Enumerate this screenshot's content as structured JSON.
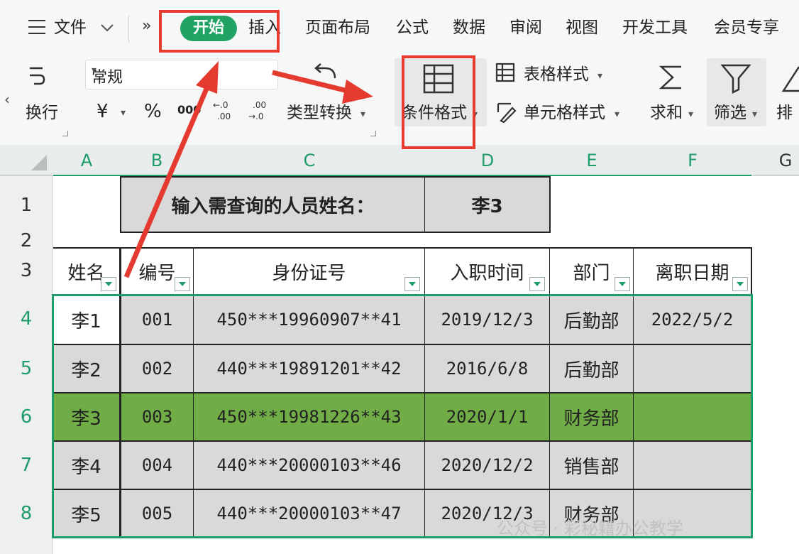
{
  "menu": {
    "file_label": "文件",
    "tabs": [
      "开始",
      "插入",
      "页面布局",
      "公式",
      "数据",
      "审阅",
      "视图",
      "开发工具",
      "会员专享"
    ],
    "active_tab": "开始"
  },
  "ribbon": {
    "wrap_label": "换行",
    "number_format": "常规",
    "currency_symbol": "¥",
    "percent_symbol": "%",
    "thousands_symbol": "000",
    "type_convert_label": "类型转换",
    "conditional_format_label": "条件格式",
    "table_style_label": "表格样式",
    "cell_style_label": "单元格样式",
    "sum_label": "求和",
    "filter_label": "筛选",
    "sort_label": "排"
  },
  "grid": {
    "columns": [
      "A",
      "B",
      "C",
      "D",
      "E",
      "F",
      "G"
    ],
    "rows": [
      "1",
      "2",
      "3",
      "4",
      "5",
      "6",
      "7",
      "8"
    ],
    "query_label": "输入需查询的人员姓名：",
    "query_value": "李3",
    "headers": [
      "姓名",
      "编号",
      "身份证号",
      "入职时间",
      "部门",
      "离职日期"
    ],
    "records": [
      {
        "name": "李1",
        "id": "001",
        "idcard": "450***19960907**41",
        "hire": "2019/12/3",
        "dept": "后勤部",
        "leave": "2022/5/2",
        "highlight": false
      },
      {
        "name": "李2",
        "id": "002",
        "idcard": "440***19891201**42",
        "hire": "2016/6/8",
        "dept": "后勤部",
        "leave": "",
        "highlight": false
      },
      {
        "name": "李3",
        "id": "003",
        "idcard": "450***19981226**43",
        "hire": "2020/1/1",
        "dept": "财务部",
        "leave": "",
        "highlight": true
      },
      {
        "name": "李4",
        "id": "004",
        "idcard": "440***20000103**46",
        "hire": "2020/12/2",
        "dept": "销售部",
        "leave": "",
        "highlight": false
      },
      {
        "name": "李5",
        "id": "005",
        "idcard": "440***20000103**47",
        "hire": "2020/12/3",
        "dept": "财务部",
        "leave": "",
        "highlight": false
      }
    ]
  },
  "watermark": "公众号 · 彩秘籍办公教学",
  "colors": {
    "accent": "#21a366",
    "highlight": "#70ad47",
    "annotation": "#e43a2f",
    "cell_gray": "#d9d9d9"
  }
}
